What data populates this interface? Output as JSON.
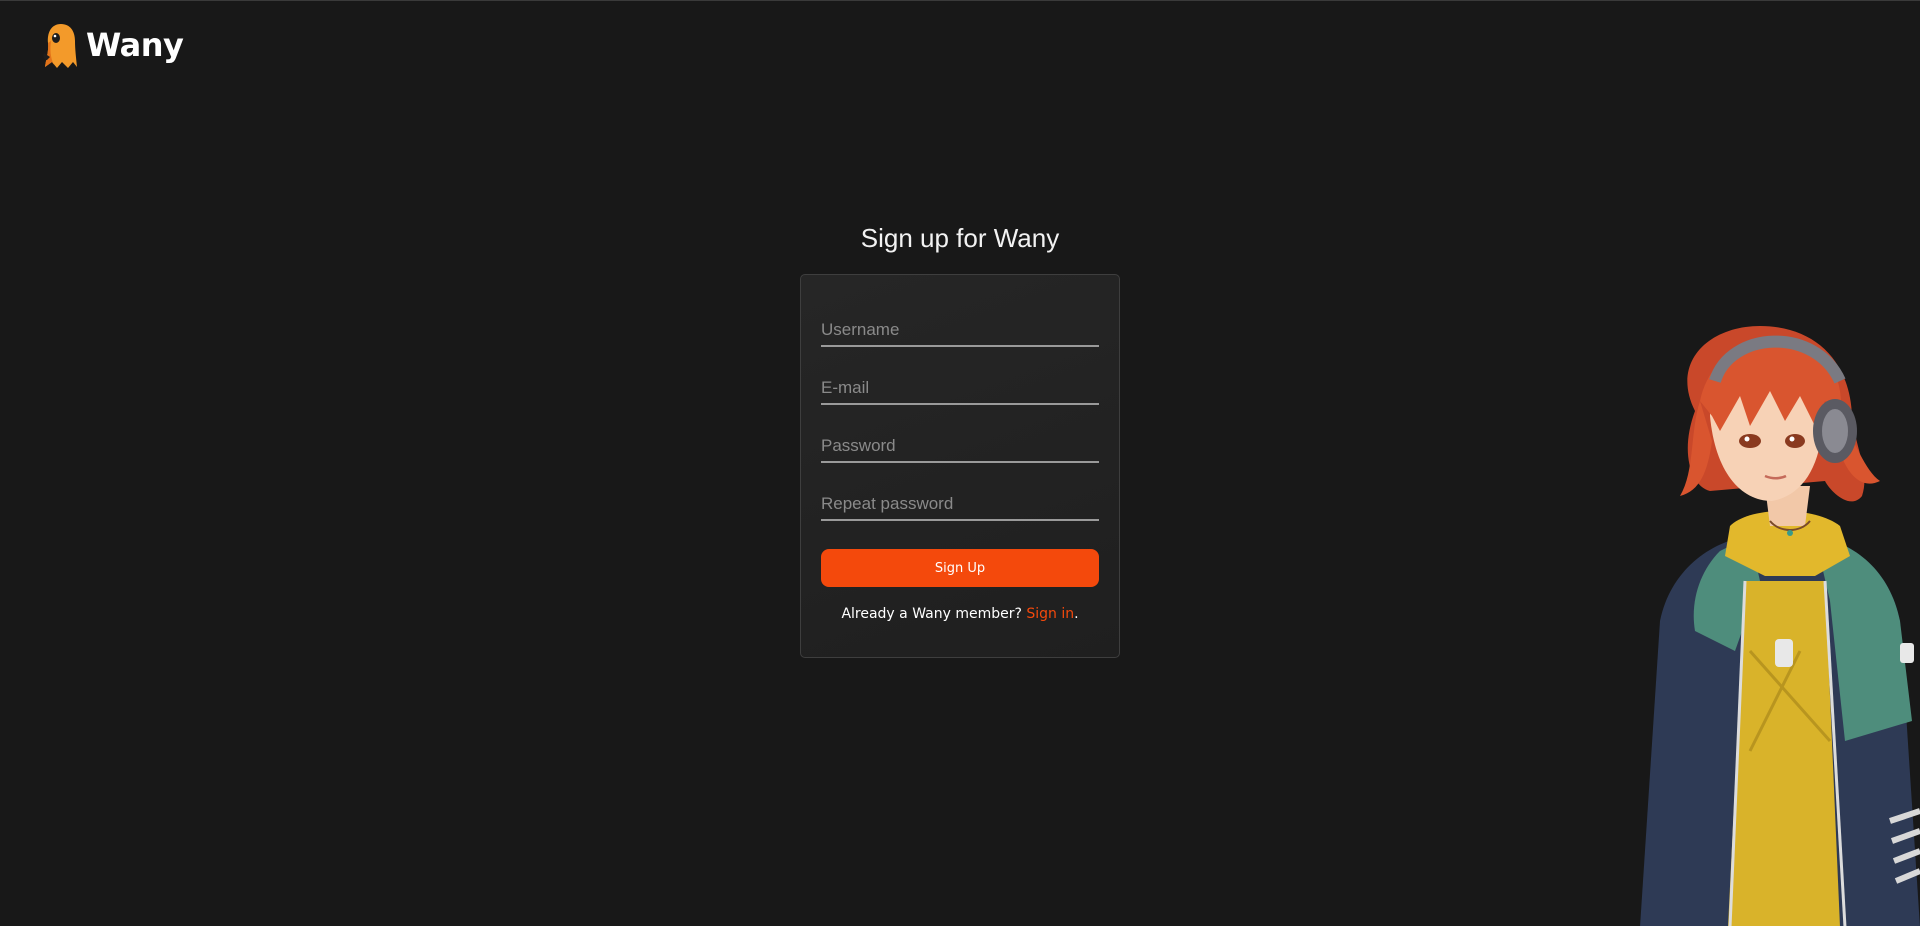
{
  "brand": {
    "name": "Wany",
    "accent_color": "#f4490c",
    "logo_icon": "ghost-mascot-icon"
  },
  "signup": {
    "title": "Sign up for Wany",
    "fields": {
      "username_placeholder": "Username",
      "email_placeholder": "E-mail",
      "password_placeholder": "Password",
      "repeat_password_placeholder": "Repeat password"
    },
    "submit_label": "Sign Up",
    "member_prompt": "Already a Wany member? ",
    "signin_label": "Sign in",
    "signin_suffix": "."
  },
  "illustration": {
    "icon": "anime-girl-headphones-illustration"
  },
  "colors": {
    "background": "#181818",
    "card_border": "#3e3e3e"
  }
}
